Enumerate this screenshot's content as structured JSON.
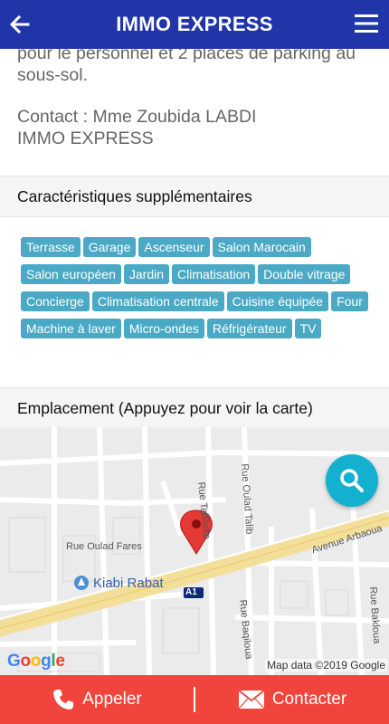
{
  "header": {
    "title": "IMMO EXPRESS"
  },
  "description": {
    "lines": [
      "pour le personnel et 2 places de parking au sous-sol.",
      "Contact : Mme Zoubida LABDI\nIMMO EXPRESS"
    ]
  },
  "features": {
    "heading": "Caractéristiques supplémentaires",
    "tags": [
      "Terrasse",
      "Garage",
      "Ascenseur",
      "Salon Marocain",
      "Salon européen",
      "Jardin",
      "Climatisation",
      "Double vitrage",
      "Concierge",
      "Climatisation centrale",
      "Cuisine équipée",
      "Four",
      "Machine à laver",
      "Micro-ondes",
      "Réfrigérateur",
      "TV"
    ]
  },
  "location": {
    "heading": "Emplacement (Appuyez pour voir la carte)",
    "map": {
      "streets": [
        "Rue Oulad Talib",
        "Rue Taffilalte",
        "Rue Oulad Fares",
        "Avenue Arbaoua",
        "Rue Baqiloua",
        "Rue Bakloua"
      ],
      "poi": "Kiabi Rabat",
      "marker_label": "A1",
      "logo": "Google",
      "attribution": "Map data ©2019 Google"
    }
  },
  "actions": {
    "call": "Appeler",
    "contact": "Contacter"
  },
  "colors": {
    "header": "#1f35a8",
    "tag": "#4aa9c5",
    "fab": "#13b1cf",
    "bottom_bar": "#f0443c"
  }
}
